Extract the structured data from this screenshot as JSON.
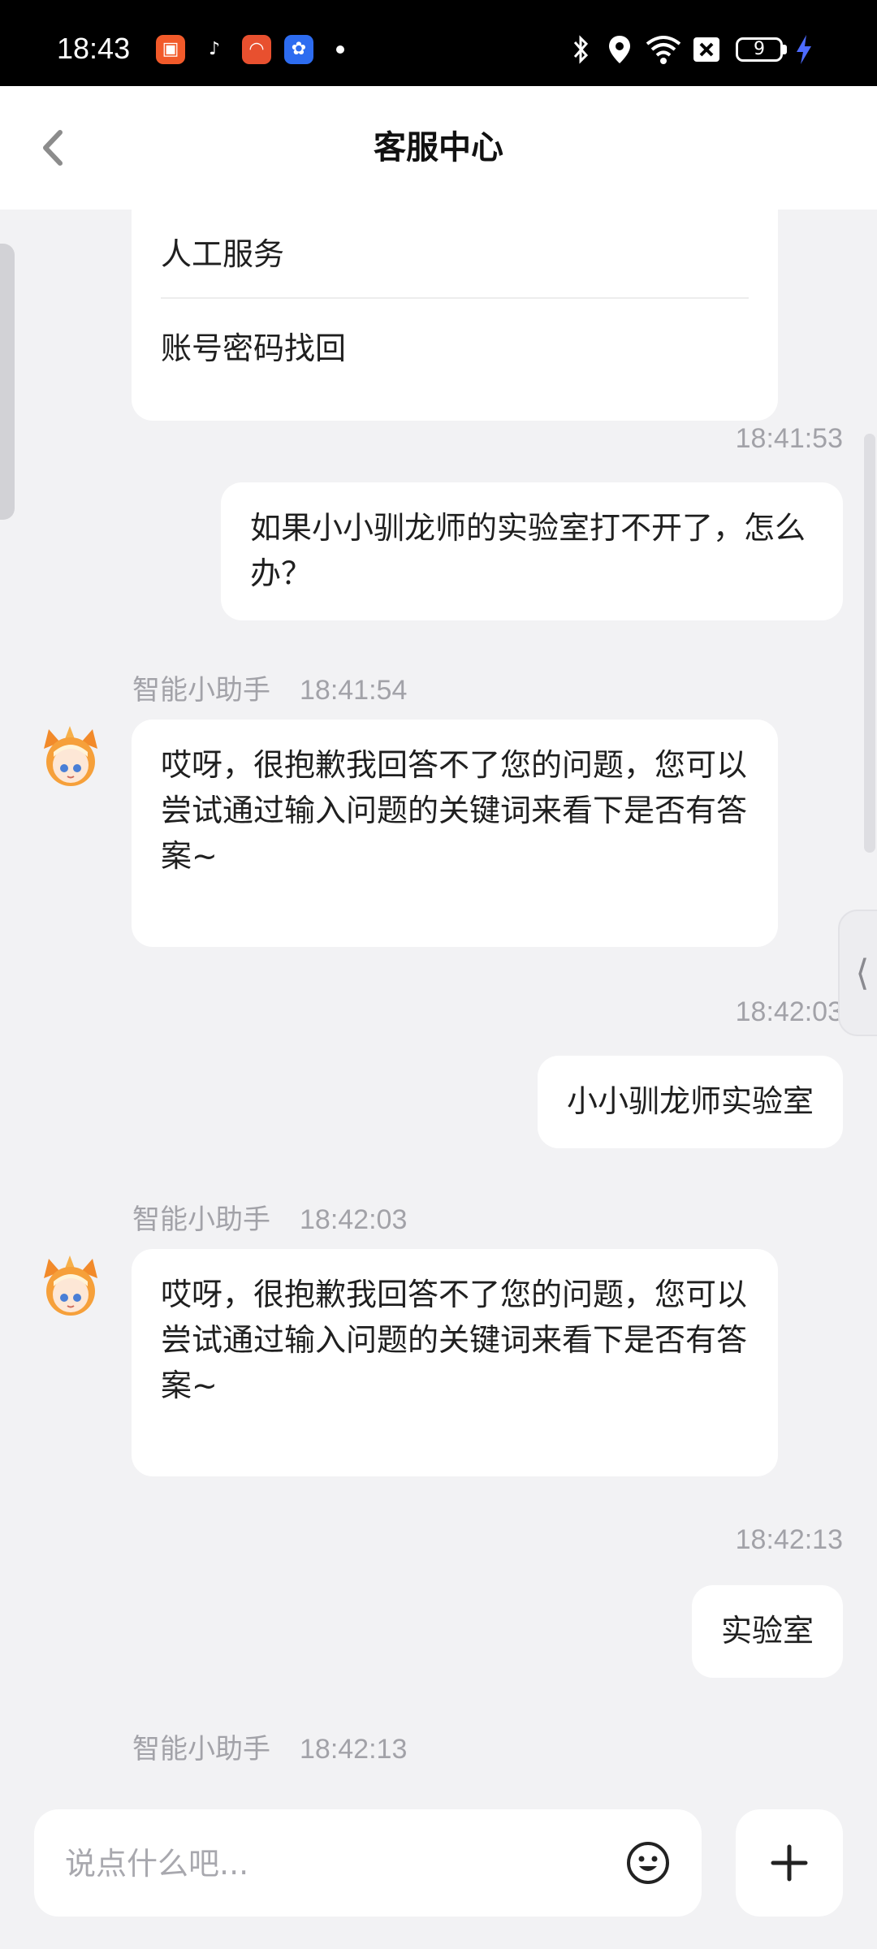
{
  "status_bar": {
    "time": "18:43",
    "battery": "9",
    "icons": [
      "bluetooth-icon",
      "location-icon",
      "wifi-icon",
      "sim-blocked-icon",
      "battery-icon",
      "charging-icon"
    ]
  },
  "header": {
    "title": "客服中心",
    "back_icon": "chevron-left-icon"
  },
  "menu_card": {
    "items": [
      "人工服务",
      "账号密码找回"
    ]
  },
  "messages": [
    {
      "from": "user",
      "time": "18:41:53",
      "text": "如果小小驯龙师的实验室打不开了，怎么办？"
    },
    {
      "from": "bot",
      "sender": "智能小助手",
      "time": "18:41:54",
      "text": "哎呀，很抱歉我回答不了您的问题，您可以尝试通过输入问题的关键词来看下是否有答案~"
    },
    {
      "from": "user",
      "time": "18:42:03",
      "text": "小小驯龙师实验室"
    },
    {
      "from": "bot",
      "sender": "智能小助手",
      "time": "18:42:03",
      "text": "哎呀，很抱歉我回答不了您的问题，您可以尝试通过输入问题的关键词来看下是否有答案~"
    },
    {
      "from": "user",
      "time": "18:42:13",
      "text": "实验室"
    },
    {
      "from": "bot",
      "sender": "智能小助手",
      "time": "18:42:13",
      "text": ""
    }
  ],
  "input": {
    "placeholder": "说点什么吧...",
    "value": "",
    "emoji_icon": "emoji-icon",
    "plus_icon": "plus-icon"
  },
  "colors": {
    "background": "#f2f2f4",
    "bubble": "#ffffff",
    "meta_text": "#a2a2a8",
    "status_bar": "#000000"
  }
}
